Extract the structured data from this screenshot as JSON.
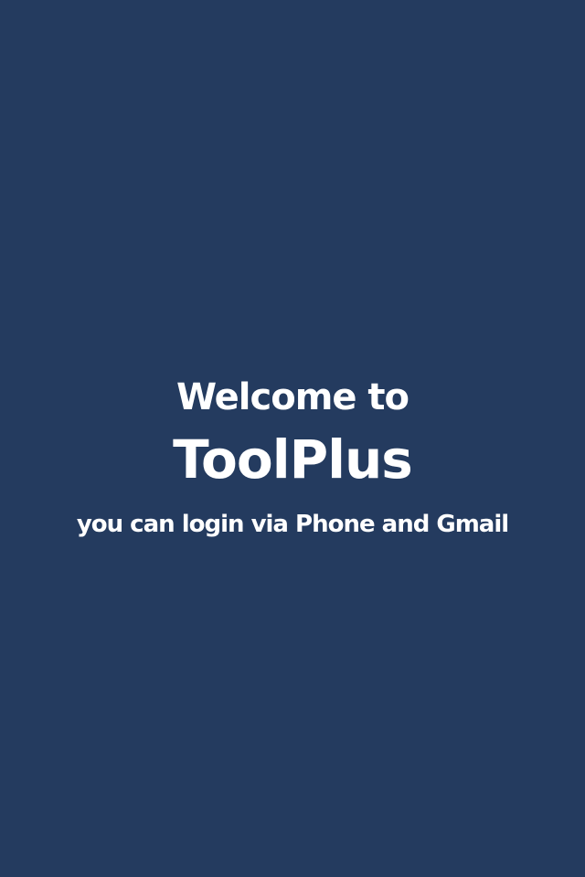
{
  "welcome": {
    "line1": "Welcome to",
    "app_name": "ToolPlus",
    "subtitle": "you can login via Phone and Gmail"
  },
  "colors": {
    "background": "#243b5f",
    "text": "#ffffff"
  }
}
